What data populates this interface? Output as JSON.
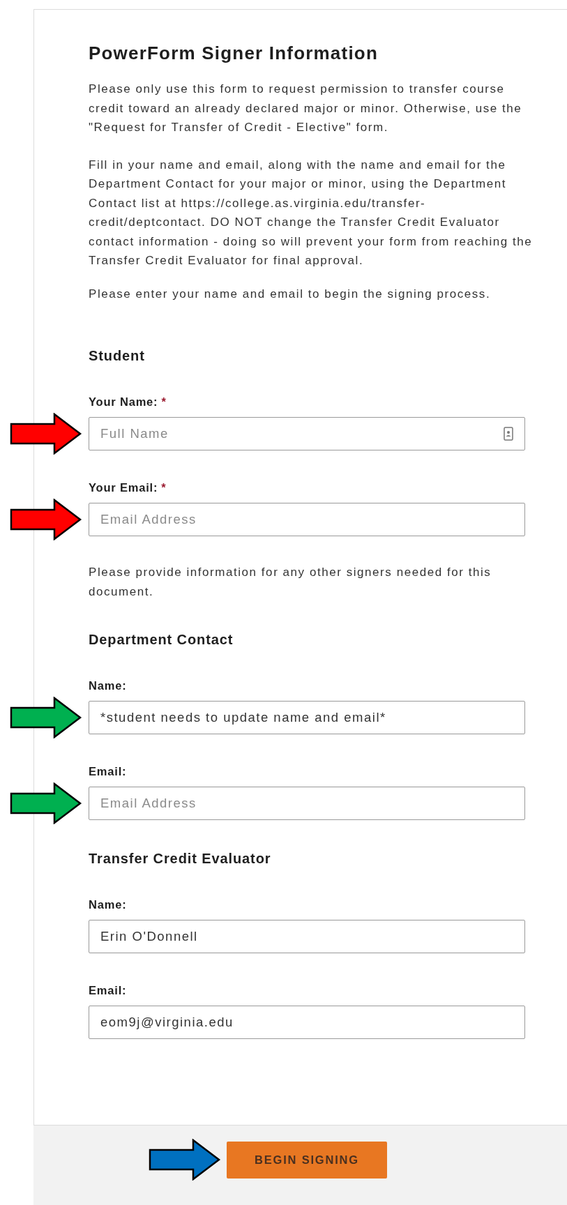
{
  "title": "PowerForm Signer Information",
  "intro": [
    "Please only use this form to request permission to transfer course credit toward an already declared major or minor. Otherwise, use the \"Request for Transfer of Credit - Elective\" form.",
    "Fill in your name and email, along with the name and email for the Department Contact for your major or minor, using the Department Contact list at https://college.as.virginia.edu/transfer-credit/deptcontact. DO NOT change the Transfer Credit Evaluator contact information - doing so will prevent your form from reaching the Transfer Credit Evaluator for final approval.",
    "Please enter your name and email to begin the signing process."
  ],
  "sections": [
    {
      "heading": "Student",
      "fields": [
        {
          "label": "Your Name:",
          "required_mark": "*",
          "placeholder": "Full Name",
          "contact_icon": true,
          "arrow": {
            "color": "#ff0000"
          }
        },
        {
          "label": "Your Email:",
          "required_mark": "*",
          "placeholder": "Email Address",
          "contact_icon": false,
          "arrow": {
            "color": "#ff0000"
          }
        }
      ]
    },
    {
      "note": "Please provide information for any other signers needed for this document.",
      "heading": "Department Contact",
      "fields": [
        {
          "label": "Name:",
          "value": "*student needs to update name and email*",
          "contact_icon": false,
          "arrow": {
            "color": "#00b050"
          }
        },
        {
          "label": "Email:",
          "placeholder": "Email Address",
          "contact_icon": false,
          "arrow": {
            "color": "#00b050"
          }
        }
      ]
    },
    {
      "heading": "Transfer Credit Evaluator",
      "fields": [
        {
          "label": "Name:",
          "value": "Erin O'Donnell",
          "contact_icon": false
        },
        {
          "label": "Email:",
          "value": "eom9j@virginia.edu",
          "contact_icon": false
        }
      ]
    }
  ],
  "footer": {
    "button": "BEGIN SIGNING",
    "arrow": {
      "color": "#0070c0"
    }
  }
}
